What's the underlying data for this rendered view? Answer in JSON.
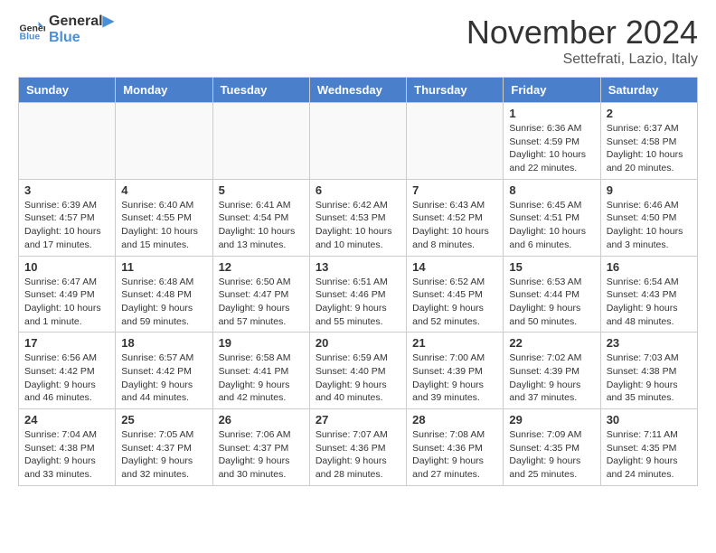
{
  "header": {
    "logo_line1": "General",
    "logo_line2": "Blue",
    "month_title": "November 2024",
    "location": "Settefrati, Lazio, Italy"
  },
  "weekdays": [
    "Sunday",
    "Monday",
    "Tuesday",
    "Wednesday",
    "Thursday",
    "Friday",
    "Saturday"
  ],
  "weeks": [
    [
      {
        "day": "",
        "info": ""
      },
      {
        "day": "",
        "info": ""
      },
      {
        "day": "",
        "info": ""
      },
      {
        "day": "",
        "info": ""
      },
      {
        "day": "",
        "info": ""
      },
      {
        "day": "1",
        "info": "Sunrise: 6:36 AM\nSunset: 4:59 PM\nDaylight: 10 hours and 22 minutes."
      },
      {
        "day": "2",
        "info": "Sunrise: 6:37 AM\nSunset: 4:58 PM\nDaylight: 10 hours and 20 minutes."
      }
    ],
    [
      {
        "day": "3",
        "info": "Sunrise: 6:39 AM\nSunset: 4:57 PM\nDaylight: 10 hours and 17 minutes."
      },
      {
        "day": "4",
        "info": "Sunrise: 6:40 AM\nSunset: 4:55 PM\nDaylight: 10 hours and 15 minutes."
      },
      {
        "day": "5",
        "info": "Sunrise: 6:41 AM\nSunset: 4:54 PM\nDaylight: 10 hours and 13 minutes."
      },
      {
        "day": "6",
        "info": "Sunrise: 6:42 AM\nSunset: 4:53 PM\nDaylight: 10 hours and 10 minutes."
      },
      {
        "day": "7",
        "info": "Sunrise: 6:43 AM\nSunset: 4:52 PM\nDaylight: 10 hours and 8 minutes."
      },
      {
        "day": "8",
        "info": "Sunrise: 6:45 AM\nSunset: 4:51 PM\nDaylight: 10 hours and 6 minutes."
      },
      {
        "day": "9",
        "info": "Sunrise: 6:46 AM\nSunset: 4:50 PM\nDaylight: 10 hours and 3 minutes."
      }
    ],
    [
      {
        "day": "10",
        "info": "Sunrise: 6:47 AM\nSunset: 4:49 PM\nDaylight: 10 hours and 1 minute."
      },
      {
        "day": "11",
        "info": "Sunrise: 6:48 AM\nSunset: 4:48 PM\nDaylight: 9 hours and 59 minutes."
      },
      {
        "day": "12",
        "info": "Sunrise: 6:50 AM\nSunset: 4:47 PM\nDaylight: 9 hours and 57 minutes."
      },
      {
        "day": "13",
        "info": "Sunrise: 6:51 AM\nSunset: 4:46 PM\nDaylight: 9 hours and 55 minutes."
      },
      {
        "day": "14",
        "info": "Sunrise: 6:52 AM\nSunset: 4:45 PM\nDaylight: 9 hours and 52 minutes."
      },
      {
        "day": "15",
        "info": "Sunrise: 6:53 AM\nSunset: 4:44 PM\nDaylight: 9 hours and 50 minutes."
      },
      {
        "day": "16",
        "info": "Sunrise: 6:54 AM\nSunset: 4:43 PM\nDaylight: 9 hours and 48 minutes."
      }
    ],
    [
      {
        "day": "17",
        "info": "Sunrise: 6:56 AM\nSunset: 4:42 PM\nDaylight: 9 hours and 46 minutes."
      },
      {
        "day": "18",
        "info": "Sunrise: 6:57 AM\nSunset: 4:42 PM\nDaylight: 9 hours and 44 minutes."
      },
      {
        "day": "19",
        "info": "Sunrise: 6:58 AM\nSunset: 4:41 PM\nDaylight: 9 hours and 42 minutes."
      },
      {
        "day": "20",
        "info": "Sunrise: 6:59 AM\nSunset: 4:40 PM\nDaylight: 9 hours and 40 minutes."
      },
      {
        "day": "21",
        "info": "Sunrise: 7:00 AM\nSunset: 4:39 PM\nDaylight: 9 hours and 39 minutes."
      },
      {
        "day": "22",
        "info": "Sunrise: 7:02 AM\nSunset: 4:39 PM\nDaylight: 9 hours and 37 minutes."
      },
      {
        "day": "23",
        "info": "Sunrise: 7:03 AM\nSunset: 4:38 PM\nDaylight: 9 hours and 35 minutes."
      }
    ],
    [
      {
        "day": "24",
        "info": "Sunrise: 7:04 AM\nSunset: 4:38 PM\nDaylight: 9 hours and 33 minutes."
      },
      {
        "day": "25",
        "info": "Sunrise: 7:05 AM\nSunset: 4:37 PM\nDaylight: 9 hours and 32 minutes."
      },
      {
        "day": "26",
        "info": "Sunrise: 7:06 AM\nSunset: 4:37 PM\nDaylight: 9 hours and 30 minutes."
      },
      {
        "day": "27",
        "info": "Sunrise: 7:07 AM\nSunset: 4:36 PM\nDaylight: 9 hours and 28 minutes."
      },
      {
        "day": "28",
        "info": "Sunrise: 7:08 AM\nSunset: 4:36 PM\nDaylight: 9 hours and 27 minutes."
      },
      {
        "day": "29",
        "info": "Sunrise: 7:09 AM\nSunset: 4:35 PM\nDaylight: 9 hours and 25 minutes."
      },
      {
        "day": "30",
        "info": "Sunrise: 7:11 AM\nSunset: 4:35 PM\nDaylight: 9 hours and 24 minutes."
      }
    ]
  ]
}
